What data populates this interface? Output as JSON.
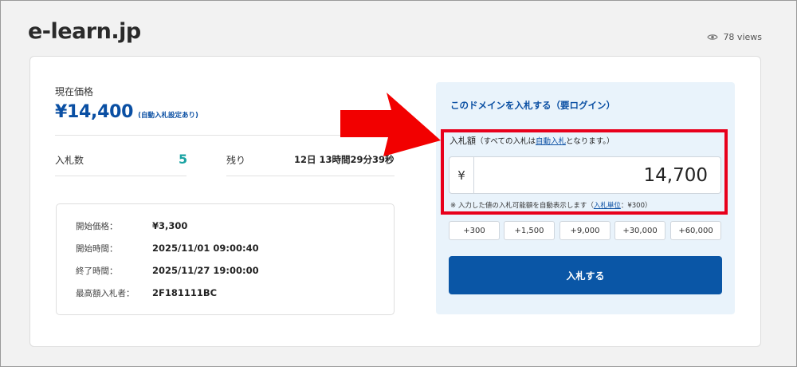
{
  "page": {
    "domain": "e-learn.jp",
    "views": "78 views"
  },
  "price": {
    "label": "現在価格",
    "value": "¥14,400",
    "note": "(自動入札設定あり)"
  },
  "stats": {
    "bids_label": "入札数",
    "bids_count": "5",
    "remaining_label": "残り",
    "remaining_value": "12日 13時間29分39秒"
  },
  "info": [
    {
      "key": "開始価格：",
      "value": "¥3,300"
    },
    {
      "key": "開始時間：",
      "value": "2025/11/01 09:00:40"
    },
    {
      "key": "終了時間：",
      "value": "2025/11/27 19:00:00"
    },
    {
      "key": "最高額入札者：",
      "value": "2F181111BC"
    }
  ],
  "bid": {
    "title": "このドメインを入札する（要ログイン）",
    "amount_label": "入札額",
    "amount_note_pre": "（すべての入札は",
    "amount_note_link": "自動入札",
    "amount_note_post": "となります。）",
    "currency": "¥",
    "amount_value": "14,700",
    "hint_pre": "※ 入力した値の入札可能額を自動表示します（",
    "hint_link": "入札単位",
    "hint_post": "：¥300）",
    "increments": [
      "+300",
      "+1,500",
      "+9,000",
      "+30,000",
      "+60,000"
    ],
    "submit_label": "入札する"
  },
  "colors": {
    "accent": "#0a4fa3",
    "count": "#1aa3a3",
    "highlight": "#e8001c",
    "arrow": "#f20000"
  },
  "icons": {
    "views": "eye-icon",
    "annotation": "red-arrow-icon"
  }
}
